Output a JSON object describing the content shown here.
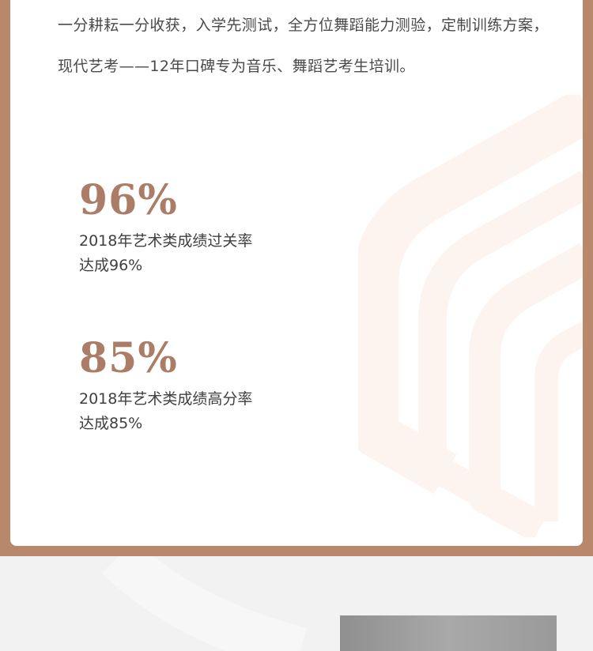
{
  "intro": {
    "text": "一分耕耘一分收获，入学先测试，全方位舞蹈能力测验，定制训练方案，现代艺考——12年口碑专为音乐、舞蹈艺考生培训。"
  },
  "stats": [
    {
      "value": "96%",
      "description": "2018年艺术类成绩过关率\n达成96%"
    },
    {
      "value": "85%",
      "description": "2018年艺术类成绩高分率\n达成85%"
    }
  ],
  "colors": {
    "frame": "#b9876a",
    "accent": "#ab7d67",
    "deco": "#fdf3ef"
  },
  "icons": {
    "background": "layered-hexagon-outline"
  }
}
